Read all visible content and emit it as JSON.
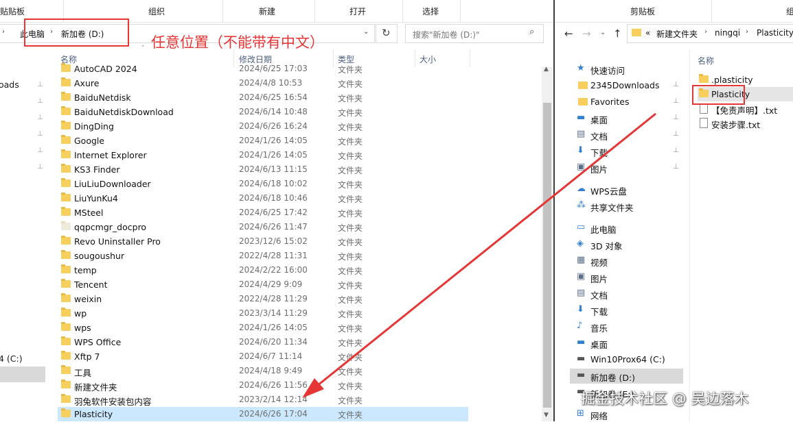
{
  "left_window": {
    "ribbon_tabs": [
      "贴贴板",
      "组织",
      "新建",
      "打开",
      "选择"
    ],
    "breadcrumb": [
      "此电脑",
      "新加卷 (D:)"
    ],
    "refresh_icon": "refresh-icon",
    "search_placeholder": "搜索\"新加卷 (D:)\"",
    "annotation": "任意位置（不能带有中文）",
    "columns": {
      "name": "名称",
      "date": "修改日期",
      "type": "类型",
      "size": "大小"
    },
    "files": [
      {
        "name": "AutoCAD 2024",
        "date": "2024/6/25 17:03",
        "type": "文件夹"
      },
      {
        "name": "Axure",
        "date": "2024/4/8 10:53",
        "type": "文件夹"
      },
      {
        "name": "BaiduNetdisk",
        "date": "2024/6/25 16:54",
        "type": "文件夹"
      },
      {
        "name": "BaiduNetdiskDownload",
        "date": "2024/6/14 10:48",
        "type": "文件夹"
      },
      {
        "name": "DingDing",
        "date": "2024/6/26 16:24",
        "type": "文件夹"
      },
      {
        "name": "Google",
        "date": "2024/1/26 14:05",
        "type": "文件夹"
      },
      {
        "name": "Internet Explorer",
        "date": "2024/1/26 14:05",
        "type": "文件夹"
      },
      {
        "name": "KS3 Finder",
        "date": "2024/6/13 11:15",
        "type": "文件夹"
      },
      {
        "name": "LiuLiuDownloader",
        "date": "2024/6/18 10:02",
        "type": "文件夹"
      },
      {
        "name": "LiuYunKu4",
        "date": "2024/6/18 10:46",
        "type": "文件夹"
      },
      {
        "name": "MSteel",
        "date": "2024/6/25 17:42",
        "type": "文件夹"
      },
      {
        "name": "qqpcmgr_docpro",
        "date": "2024/6/26 11:47",
        "type": "文件夹"
      },
      {
        "name": "Revo Uninstaller Pro",
        "date": "2023/12/6 15:02",
        "type": "文件夹"
      },
      {
        "name": "sougoushur",
        "date": "2022/4/28 11:31",
        "type": "文件夹"
      },
      {
        "name": "temp",
        "date": "2024/2/22 16:00",
        "type": "文件夹"
      },
      {
        "name": "Tencent",
        "date": "2024/4/29 9:09",
        "type": "文件夹"
      },
      {
        "name": "weixin",
        "date": "2022/4/28 11:29",
        "type": "文件夹"
      },
      {
        "name": "wp",
        "date": "2023/3/14 11:29",
        "type": "文件夹"
      },
      {
        "name": "wps",
        "date": "2024/1/26 14:05",
        "type": "文件夹"
      },
      {
        "name": "WPS Office",
        "date": "2024/6/20 11:34",
        "type": "文件夹"
      },
      {
        "name": "Xftp 7",
        "date": "2024/6/7 11:14",
        "type": "文件夹"
      },
      {
        "name": "工具",
        "date": "2024/4/18 9:49",
        "type": "文件夹"
      },
      {
        "name": "新建文件夹",
        "date": "2024/6/26 11:56",
        "type": "文件夹"
      },
      {
        "name": "羽兔软件安装包内容",
        "date": "2023/2/14 12:14",
        "type": "文件夹"
      },
      {
        "name": "Plasticity",
        "date": "2024/6/26 17:04",
        "type": "文件夹"
      }
    ],
    "left_partial_labels": [
      "oads",
      "4 (C:)"
    ]
  },
  "right_window": {
    "ribbon_tabs": [
      "剪贴板",
      "组"
    ],
    "breadcrumb": [
      "«",
      "新建文件夹",
      "ningqi",
      "Plasticity"
    ],
    "column_name": "名称",
    "nav_items": [
      {
        "label": "快速访问",
        "icon": "star-icon"
      },
      {
        "label": "2345Downloads",
        "icon": "folder-icon",
        "pin": true
      },
      {
        "label": "Favorites",
        "icon": "folder-icon",
        "pin": true
      },
      {
        "label": "桌面",
        "icon": "desktop-icon",
        "pin": true
      },
      {
        "label": "文档",
        "icon": "document-icon",
        "pin": true
      },
      {
        "label": "下载",
        "icon": "download-icon",
        "pin": true
      },
      {
        "label": "图片",
        "icon": "picture-icon",
        "pin": true
      },
      {
        "label": "WPS云盘",
        "icon": "cloud-icon"
      },
      {
        "label": "共享文件夹",
        "icon": "share-icon"
      },
      {
        "label": "此电脑",
        "icon": "computer-icon"
      },
      {
        "label": "3D 对象",
        "icon": "cube-icon"
      },
      {
        "label": "视频",
        "icon": "video-icon"
      },
      {
        "label": "图片",
        "icon": "picture-icon"
      },
      {
        "label": "文档",
        "icon": "document-icon"
      },
      {
        "label": "下载",
        "icon": "download-icon"
      },
      {
        "label": "音乐",
        "icon": "music-icon"
      },
      {
        "label": "桌面",
        "icon": "desktop-icon"
      },
      {
        "label": "Win10Prox64 (C:)",
        "icon": "drive-icon"
      },
      {
        "label": "新加卷 (D:)",
        "icon": "drive-icon"
      },
      {
        "label": "新加卷 (E:)",
        "icon": "drive-icon"
      },
      {
        "label": "网络",
        "icon": "network-icon"
      }
    ],
    "files": [
      {
        "name": ".plasticity",
        "icon": "folder-icon"
      },
      {
        "name": "Plasticity",
        "icon": "folder-icon"
      },
      {
        "name": "【免责声明】.txt",
        "icon": "text-file-icon"
      },
      {
        "name": "安装步骤.txt",
        "icon": "text-file-icon"
      }
    ]
  },
  "watermark": "掘金技术社区 @ 吴边落木",
  "colors": {
    "annotation": "#e53535",
    "selected_row": "#cce8ff",
    "folder": "#f6cf5c"
  }
}
